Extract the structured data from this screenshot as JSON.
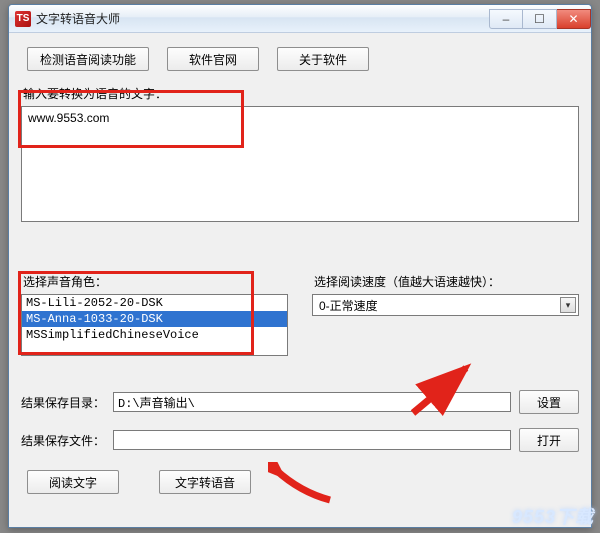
{
  "window": {
    "title": "文字转语音大师",
    "icon_text": "TS"
  },
  "win_controls": {
    "min": "–",
    "max": "☐",
    "close": "✕"
  },
  "toolbar": {
    "detect_label": "检测语音阅读功能",
    "official_label": "软件官网",
    "about_label": "关于软件"
  },
  "input_section": {
    "label": "输入要转换为语音的文字：",
    "text": "www.9553.com"
  },
  "voice_section": {
    "label": "选择声音角色：",
    "items": [
      "MS-Lili-2052-20-DSK",
      "MS-Anna-1033-20-DSK",
      "MSSimplifiedChineseVoice"
    ],
    "selected_index": 1
  },
  "speed_section": {
    "label": "选择阅读速度（值越大语速越快）：",
    "value": "0-正常速度"
  },
  "save_dir": {
    "label": "结果保存目录：",
    "value": "D:\\声音输出\\",
    "button": "设置"
  },
  "save_file": {
    "label": "结果保存文件：",
    "value": "",
    "button": "打开"
  },
  "bottom": {
    "read_label": "阅读文字",
    "convert_label": "文字转语音"
  },
  "watermark": "9553下载"
}
